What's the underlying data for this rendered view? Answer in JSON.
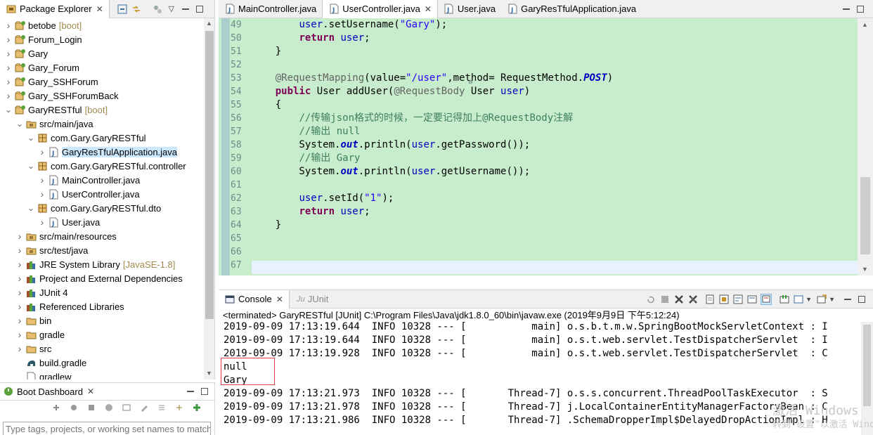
{
  "explorer": {
    "title": "Package Explorer",
    "items": [
      {
        "label": "betobe",
        "deco": "[boot]",
        "indent": 0,
        "open": false,
        "icon": "project",
        "sel": false
      },
      {
        "label": "Forum_Login",
        "deco": "",
        "indent": 0,
        "open": false,
        "icon": "project",
        "sel": false
      },
      {
        "label": "Gary",
        "deco": "",
        "indent": 0,
        "open": false,
        "icon": "project",
        "sel": false
      },
      {
        "label": "Gary_Forum",
        "deco": "",
        "indent": 0,
        "open": false,
        "icon": "project",
        "sel": false
      },
      {
        "label": "Gary_SSHForum",
        "deco": "",
        "indent": 0,
        "open": false,
        "icon": "project",
        "sel": false
      },
      {
        "label": "Gary_SSHForumBack",
        "deco": "",
        "indent": 0,
        "open": false,
        "icon": "project",
        "sel": false
      },
      {
        "label": "GaryRESTful",
        "deco": "[boot]",
        "indent": 0,
        "open": true,
        "icon": "project",
        "sel": false
      },
      {
        "label": "src/main/java",
        "deco": "",
        "indent": 1,
        "open": true,
        "icon": "srcfolder",
        "sel": false
      },
      {
        "label": "com.Gary.GaryRESTful",
        "deco": "",
        "indent": 2,
        "open": true,
        "icon": "package",
        "sel": false
      },
      {
        "label": "GaryResTfulApplication.java",
        "deco": "",
        "indent": 3,
        "open": false,
        "icon": "javafile",
        "sel": true
      },
      {
        "label": "com.Gary.GaryRESTful.controller",
        "deco": "",
        "indent": 2,
        "open": true,
        "icon": "package",
        "sel": false
      },
      {
        "label": "MainController.java",
        "deco": "",
        "indent": 3,
        "open": false,
        "icon": "javafile",
        "sel": false
      },
      {
        "label": "UserController.java",
        "deco": "",
        "indent": 3,
        "open": false,
        "icon": "javafile",
        "sel": false
      },
      {
        "label": "com.Gary.GaryRESTful.dto",
        "deco": "",
        "indent": 2,
        "open": true,
        "icon": "package",
        "sel": false
      },
      {
        "label": "User.java",
        "deco": "",
        "indent": 3,
        "open": false,
        "icon": "javafile",
        "sel": false
      },
      {
        "label": "src/main/resources",
        "deco": "",
        "indent": 1,
        "open": false,
        "icon": "srcfolder",
        "sel": false
      },
      {
        "label": "src/test/java",
        "deco": "",
        "indent": 1,
        "open": false,
        "icon": "srcfolder",
        "sel": false
      },
      {
        "label": "JRE System Library",
        "deco": "[JavaSE-1.8]",
        "indent": 1,
        "open": false,
        "icon": "library",
        "sel": false
      },
      {
        "label": "Project and External Dependencies",
        "deco": "",
        "indent": 1,
        "open": false,
        "icon": "library",
        "sel": false
      },
      {
        "label": "JUnit 4",
        "deco": "",
        "indent": 1,
        "open": false,
        "icon": "library",
        "sel": false
      },
      {
        "label": "Referenced Libraries",
        "deco": "",
        "indent": 1,
        "open": false,
        "icon": "library",
        "sel": false
      },
      {
        "label": "bin",
        "deco": "",
        "indent": 1,
        "open": false,
        "icon": "folder",
        "sel": false
      },
      {
        "label": "gradle",
        "deco": "",
        "indent": 1,
        "open": false,
        "icon": "folder",
        "sel": false
      },
      {
        "label": "src",
        "deco": "",
        "indent": 1,
        "open": false,
        "icon": "folder",
        "sel": false
      },
      {
        "label": "build.gradle",
        "deco": "",
        "indent": 1,
        "open": null,
        "icon": "gradle",
        "sel": false
      },
      {
        "label": "gradlew",
        "deco": "",
        "indent": 1,
        "open": null,
        "icon": "file",
        "sel": false
      }
    ]
  },
  "boot": {
    "title": "Boot Dashboard",
    "filter_placeholder": "Type tags, projects, or working set names to match"
  },
  "editor": {
    "tabs": [
      {
        "label": "MainController.java",
        "active": false,
        "close": false
      },
      {
        "label": "UserController.java",
        "active": true,
        "close": true
      },
      {
        "label": "User.java",
        "active": false,
        "close": false
      },
      {
        "label": "GaryResTfulApplication.java",
        "active": false,
        "close": false
      }
    ],
    "line_numbers": [
      "49",
      "50",
      "51",
      "52",
      "53",
      "54",
      "55",
      "56",
      "57",
      "58",
      "59",
      "60",
      "61",
      "62",
      "63",
      "64",
      "65",
      "66",
      "67"
    ],
    "lines": [
      [
        {
          "t": "        "
        },
        {
          "t": "user",
          "c": "fld"
        },
        {
          "t": ".setUsername("
        },
        {
          "t": "\"Gary\"",
          "c": "str"
        },
        {
          "t": ");"
        }
      ],
      [
        {
          "t": "        "
        },
        {
          "t": "return",
          "c": "kw"
        },
        {
          "t": " "
        },
        {
          "t": "user",
          "c": "fld"
        },
        {
          "t": ";"
        }
      ],
      [
        {
          "t": "    }"
        }
      ],
      [
        {
          "t": ""
        }
      ],
      [
        {
          "t": "    "
        },
        {
          "t": "@RequestMapping",
          "c": "ann"
        },
        {
          "t": "(value="
        },
        {
          "t": "\"/user\"",
          "c": "str"
        },
        {
          "t": ",method= RequestMethod."
        },
        {
          "t": "POST",
          "c": "sfld"
        },
        {
          "t": ")"
        }
      ],
      [
        {
          "t": "    "
        },
        {
          "t": "public",
          "c": "kw"
        },
        {
          "t": " User addUser("
        },
        {
          "t": "@RequestBody",
          "c": "ann"
        },
        {
          "t": " User "
        },
        {
          "t": "user",
          "c": "fld"
        },
        {
          "t": ")"
        }
      ],
      [
        {
          "t": "    {"
        }
      ],
      [
        {
          "t": "        "
        },
        {
          "t": "//传输json格式的时候，一定要记得加上@RequestBody注解",
          "c": "cmt"
        }
      ],
      [
        {
          "t": "        "
        },
        {
          "t": "//输出 null",
          "c": "cmt"
        }
      ],
      [
        {
          "t": "        System."
        },
        {
          "t": "out",
          "c": "sfld"
        },
        {
          "t": ".println("
        },
        {
          "t": "user",
          "c": "fld"
        },
        {
          "t": ".getPassword());"
        }
      ],
      [
        {
          "t": "        "
        },
        {
          "t": "//输出 Gary",
          "c": "cmt"
        }
      ],
      [
        {
          "t": "        System."
        },
        {
          "t": "out",
          "c": "sfld"
        },
        {
          "t": ".println("
        },
        {
          "t": "user",
          "c": "fld"
        },
        {
          "t": ".getUsername());"
        }
      ],
      [
        {
          "t": ""
        }
      ],
      [
        {
          "t": "        "
        },
        {
          "t": "user",
          "c": "fld"
        },
        {
          "t": ".setId("
        },
        {
          "t": "\"1\"",
          "c": "str"
        },
        {
          "t": ");"
        }
      ],
      [
        {
          "t": "        "
        },
        {
          "t": "return",
          "c": "kw"
        },
        {
          "t": " "
        },
        {
          "t": "user",
          "c": "fld"
        },
        {
          "t": ";"
        }
      ],
      [
        {
          "t": "    }"
        }
      ],
      [
        {
          "t": ""
        }
      ],
      [
        {
          "t": ""
        }
      ],
      [
        {
          "t": ""
        }
      ]
    ]
  },
  "console": {
    "tab_label": "Console",
    "junit_label": "JUnit",
    "status": "<terminated> GaryRESTful [JUnit] C:\\Program Files\\Java\\jdk1.8.0_60\\bin\\javaw.exe (2019年9月9日 下午5:12:24)",
    "lines": [
      "2019-09-09 17:13:19.644  INFO 10328 --- [           main] o.s.b.t.m.w.SpringBootMockServletContext : I",
      "2019-09-09 17:13:19.644  INFO 10328 --- [           main] o.s.t.web.servlet.TestDispatcherServlet  : I",
      "2019-09-09 17:13:19.928  INFO 10328 --- [           main] o.s.t.web.servlet.TestDispatcherServlet  : C",
      "null",
      "Gary",
      "2019-09-09 17:13:21.973  INFO 10328 --- [       Thread-7] o.s.s.concurrent.ThreadPoolTaskExecutor  : S",
      "2019-09-09 17:13:21.978  INFO 10328 --- [       Thread-7] j.LocalContainerEntityManagerFactoryBean : C",
      "2019-09-09 17:13:21.986  INFO 10328 --- [       Thread-7] .SchemaDropperImpl$DelayedDropActionImpl : H"
    ]
  },
  "watermark": {
    "line1": "激活 Windows",
    "line2": "转到\"设置\"以激活 Windows。"
  },
  "colors": {
    "editor_bg": "#c7edcc",
    "highlight_box": "#e04040",
    "selection": "#cce8ff"
  }
}
